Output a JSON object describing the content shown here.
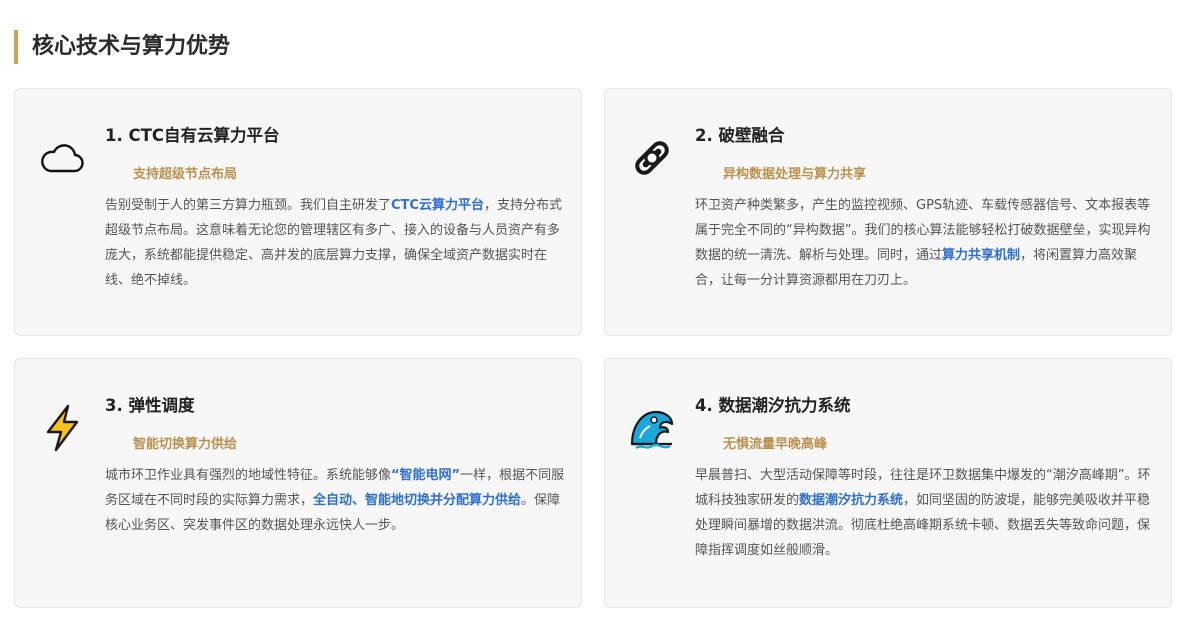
{
  "section": {
    "title": "核心技术与算力优势"
  },
  "cards": [
    {
      "icon": "cloud-icon",
      "title": "1. CTC自有云算力平台",
      "subtitle": "支持超级节点布局",
      "desc": {
        "p1": "告别受制于人的第三方算力瓶颈。我们自主研发了",
        "hl1": "CTC云算力平台",
        "p2": "，支持分布式超级节点布局。这意味着无论您的管理辖区有多广、接入的设备与人员资产有多庞大，系统都能提供稳定、高并发的底层算力支撑，确保全域资产数据实时在线、绝不掉线。"
      }
    },
    {
      "icon": "chain-link-icon",
      "title": "2. 破壁融合",
      "subtitle": "异构数据处理与算力共享",
      "desc": {
        "p1": "环卫资产种类繁多，产生的监控视频、GPS轨迹、车载传感器信号、文本报表等属于完全不同的“异构数据”。我们的核心算法能够轻松打破数据壁垒，实现异构数据的统一清洗、解析与处理。同时，通过",
        "hl1": "算力共享机制",
        "p2": "，将闲置算力高效聚合，让每一分计算资源都用在刀刃上。"
      }
    },
    {
      "icon": "lightning-icon",
      "title": "3. 弹性调度",
      "subtitle": "智能切换算力供给",
      "desc": {
        "p1": "城市环卫作业具有强烈的地域性特征。系统能够像",
        "hl1": "“智能电网”",
        "p2": "一样，根据不同服务区域在不同时段的实际算力需求，",
        "hl2": "全自动、智能地切换并分配算力供给",
        "p3": "。保障核心业务区、突发事件区的数据处理永远快人一步。"
      }
    },
    {
      "icon": "wave-icon",
      "title": "4. 数据潮汐抗力系统",
      "subtitle": "无惧流量早晚高峰",
      "desc": {
        "p1": "早晨普扫、大型活动保障等时段，往往是环卫数据集中爆发的“潮汐高峰期”。环城科技独家研发的",
        "hl1": "数据潮汐抗力系统",
        "p2": "，如同坚固的防波堤，能够完美吸收并平稳处理瞬间暴增的数据洪流。彻底杜绝高峰期系统卡顿、数据丢失等致命问题，保障指挥调度如丝般顺滑。"
      }
    }
  ]
}
